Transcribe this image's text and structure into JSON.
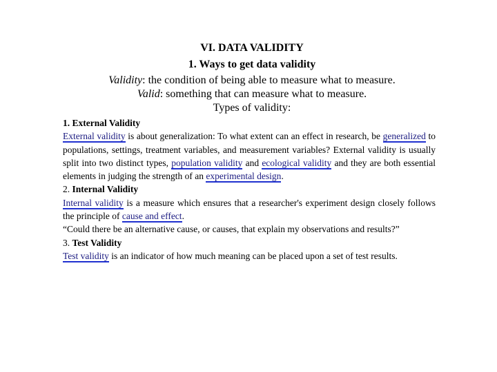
{
  "header": {
    "title": "VI. DATA VALIDITY",
    "subtitle": "1. Ways to get data  validity",
    "definition1_term": "Validity",
    "definition1_text": ": the condition of being able to measure what to measure.",
    "definition2_term": "Valid",
    "definition2_text": ": something that can measure what to measure.",
    "types_heading": "Types of validity:"
  },
  "sections": {
    "external": {
      "heading": "1. External Validity",
      "link1": "External validity",
      "text1": " is about generalization: To what extent can an effect in research, be ",
      "link2": "generalized",
      "text2": " to populations, settings, treatment variables, and measurement variables? External validity is usually split into two distinct types, ",
      "link3": "population validity",
      "text3": " and ",
      "link4": "ecological validity",
      "text4": " and they are both essential elements in judging the strength of an ",
      "link5": "experimental design",
      "text5": "."
    },
    "internal": {
      "number": "2. ",
      "heading": "Internal Validity",
      "link1": "Internal validity",
      "text1": " is a measure which ensures that a researcher's experiment design closely follows the principle of ",
      "link2": "cause and effect",
      "text2": ".",
      "quote": "“Could there be an alternative cause, or causes, that explain my observations and results?”"
    },
    "test": {
      "number": "3. ",
      "heading": "Test Validity",
      "link1": "Test validity",
      "text1": " is an indicator of how much meaning can be placed upon a set of test results."
    }
  },
  "colors": {
    "link_text": "#1a1a80",
    "link_underline": "#1e2fcf",
    "text": "#000000",
    "background": "#ffffff"
  }
}
